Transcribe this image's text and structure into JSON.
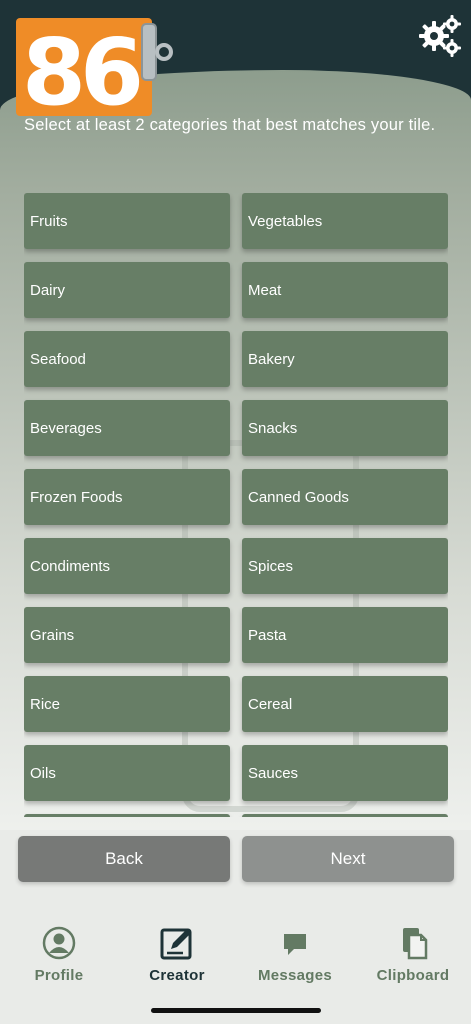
{
  "app": {
    "logo_text": "86"
  },
  "header": {
    "settings_icon": "gears-icon"
  },
  "instruction": "Select at least 2 categories that best matches your tile.",
  "categories": [
    "Fruits",
    "Vegetables",
    "Dairy",
    "Meat",
    "Seafood",
    "Bakery",
    "Beverages",
    "Snacks",
    "Frozen Foods",
    "Canned Goods",
    "Condiments",
    "Spices",
    "Grains",
    "Pasta",
    "Rice",
    "Cereal",
    "Oils",
    "Sauces",
    "",
    ""
  ],
  "actions": {
    "back_label": "Back",
    "next_label": "Next"
  },
  "tabs": [
    {
      "label": "Profile",
      "icon": "profile-icon"
    },
    {
      "label": "Creator",
      "icon": "creator-icon"
    },
    {
      "label": "Messages",
      "icon": "messages-icon"
    },
    {
      "label": "Clipboard",
      "icon": "clipboard-icon"
    }
  ],
  "colors": {
    "header": "#1e3337",
    "accent_orange": "#ef8c27",
    "category_tile": "#677e66",
    "tab_inactive": "#637a63"
  }
}
